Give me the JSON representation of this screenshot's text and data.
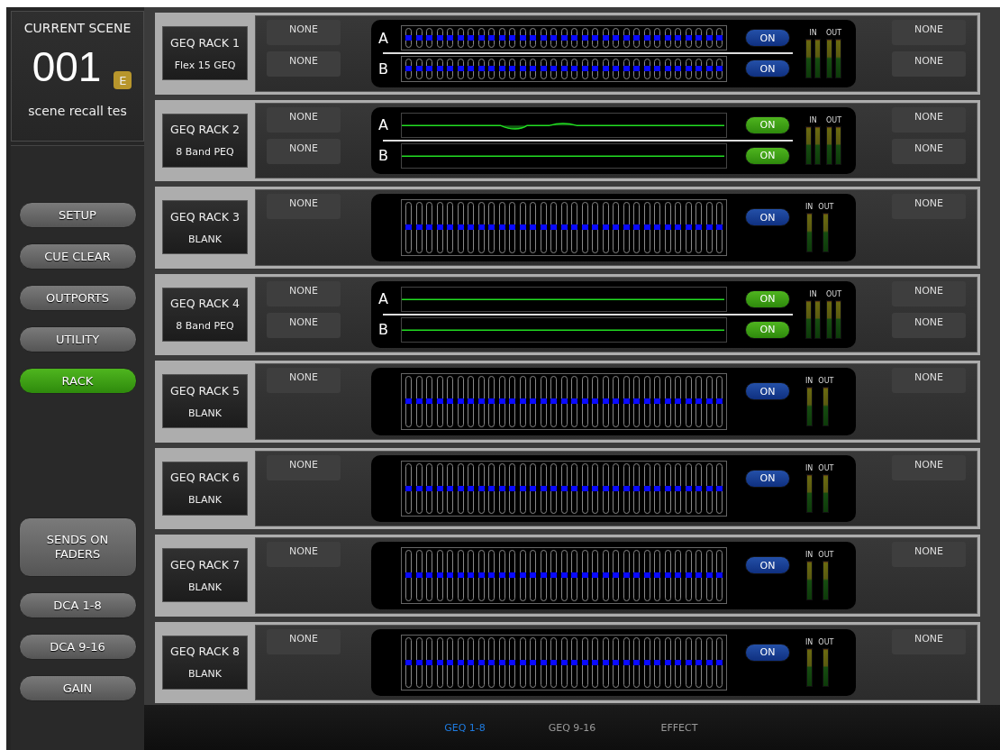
{
  "scene": {
    "title": "CURRENT SCENE",
    "number": "001",
    "badge": "E",
    "name": "scene recall tes"
  },
  "menu_top": [
    {
      "label": "SETUP",
      "selected": false
    },
    {
      "label": "CUE CLEAR",
      "selected": false
    },
    {
      "label": "OUTPORTS",
      "selected": false
    },
    {
      "label": "UTILITY",
      "selected": false
    },
    {
      "label": "RACK",
      "selected": true
    }
  ],
  "menu_bottom": [
    {
      "label": "SENDS ON FADERS",
      "selected": false,
      "kind": "large"
    },
    {
      "label": "DCA 1-8",
      "selected": false,
      "kind": "small"
    },
    {
      "label": "DCA 9-16",
      "selected": false,
      "kind": "small"
    },
    {
      "label": "GAIN",
      "selected": false,
      "kind": "small"
    }
  ],
  "racks": [
    {
      "name": "GEQ RACK 1",
      "module": "Flex 15 GEQ",
      "kind": "geq",
      "inputs": [
        "NONE",
        "NONE"
      ],
      "outputs": [
        "NONE",
        "NONE"
      ],
      "meter_in": "IN",
      "meter_out": "OUT",
      "channels": [
        {
          "label": "A",
          "button": "ON",
          "on": true,
          "level": 0.5
        },
        {
          "label": "B",
          "button": "ON",
          "on": true,
          "level": 0.5
        }
      ]
    },
    {
      "name": "GEQ RACK 2",
      "module": "8 Band PEQ",
      "kind": "peq",
      "inputs": [
        "NONE",
        "NONE"
      ],
      "outputs": [
        "NONE",
        "NONE"
      ],
      "meter_in": "IN",
      "meter_out": "OUT",
      "channels": [
        {
          "label": "A",
          "button": "ON",
          "on": true,
          "kind": "dip_peak"
        },
        {
          "label": "B",
          "button": "ON",
          "on": true,
          "kind": "flat"
        }
      ]
    },
    {
      "name": "GEQ RACK 3",
      "module": "BLANK",
      "kind": "geq",
      "inputs": [
        "NONE"
      ],
      "outputs": [
        "NONE"
      ],
      "meter_in": "IN",
      "meter_out": "OUT",
      "channels": [
        {
          "button": "ON",
          "on": true,
          "level": 0.5
        }
      ]
    },
    {
      "name": "GEQ RACK 4",
      "module": "8 Band PEQ",
      "kind": "peq",
      "inputs": [
        "NONE",
        "NONE"
      ],
      "outputs": [
        "NONE",
        "NONE"
      ],
      "meter_in": "IN",
      "meter_out": "OUT",
      "channels": [
        {
          "label": "A",
          "button": "ON",
          "on": true,
          "kind": "flat"
        },
        {
          "label": "B",
          "button": "ON",
          "on": true,
          "kind": "flat"
        }
      ]
    },
    {
      "name": "GEQ RACK 5",
      "module": "BLANK",
      "kind": "geq",
      "inputs": [
        "NONE"
      ],
      "outputs": [
        "NONE"
      ],
      "meter_in": "IN",
      "meter_out": "OUT",
      "channels": [
        {
          "button": "ON",
          "on": true,
          "level": 0.5
        }
      ]
    },
    {
      "name": "GEQ RACK 6",
      "module": "BLANK",
      "kind": "geq",
      "inputs": [
        "NONE"
      ],
      "outputs": [
        "NONE"
      ],
      "meter_in": "IN",
      "meter_out": "OUT",
      "channels": [
        {
          "button": "ON",
          "on": true,
          "level": 0.5
        }
      ]
    },
    {
      "name": "GEQ RACK 7",
      "module": "BLANK",
      "kind": "geq",
      "inputs": [
        "NONE"
      ],
      "outputs": [
        "NONE"
      ],
      "meter_in": "IN",
      "meter_out": "OUT",
      "channels": [
        {
          "button": "ON",
          "on": true,
          "level": 0.5
        }
      ]
    },
    {
      "name": "GEQ RACK 8",
      "module": "BLANK",
      "kind": "geq",
      "inputs": [
        "NONE"
      ],
      "outputs": [
        "NONE"
      ],
      "meter_in": "IN",
      "meter_out": "OUT",
      "channels": [
        {
          "button": "ON",
          "on": true,
          "level": 0.5
        }
      ]
    }
  ],
  "tabs": [
    {
      "label": "GEQ 1-8",
      "selected": true
    },
    {
      "label": "GEQ 9-16",
      "selected": false
    },
    {
      "label": "EFFECT",
      "selected": false
    }
  ]
}
